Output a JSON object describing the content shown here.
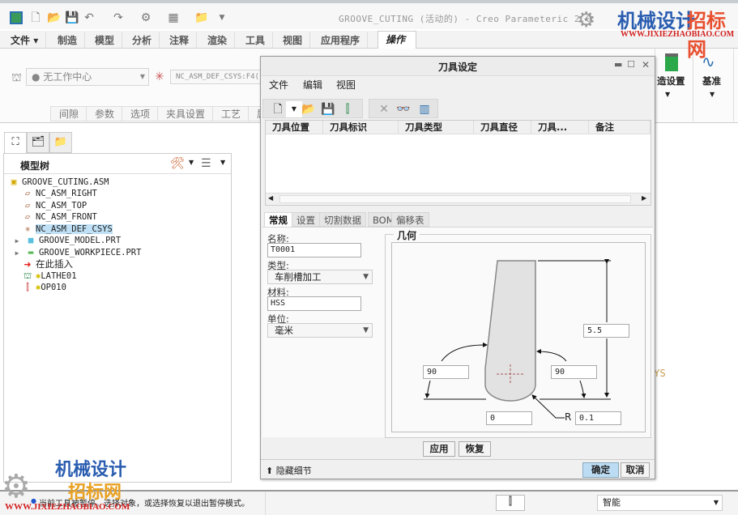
{
  "window": {
    "title": "GROOVE_CUTING (活动的) - Creo Parameteric 2.0"
  },
  "quick_access": {
    "icons": [
      "app-icon",
      "new-icon",
      "open-icon",
      "save-icon",
      "undo-icon",
      "redo-icon",
      "regenerate-icon",
      "windows-icon",
      "close-window-icon",
      "customize-icon"
    ]
  },
  "ribbon": {
    "file_label": "文件",
    "tabs": [
      {
        "label": "制造"
      },
      {
        "label": "模型"
      },
      {
        "label": "分析"
      },
      {
        "label": "注释"
      },
      {
        "label": "渲染"
      },
      {
        "label": "工具"
      },
      {
        "label": "视图"
      },
      {
        "label": "应用程序"
      },
      {
        "label": "操作"
      }
    ],
    "active_tab": "操作",
    "workcenter_value": "无工作中心",
    "csys_value": "NC_ASM_DEF_CSYS:F4(",
    "subtabs": [
      {
        "label": "间隙"
      },
      {
        "label": "参数"
      },
      {
        "label": "选项"
      },
      {
        "label": "夹具设置"
      },
      {
        "label": "工艺"
      },
      {
        "label": "属"
      }
    ],
    "groups": [
      {
        "label": "造设置"
      },
      {
        "label": "基准"
      }
    ]
  },
  "model_tree": {
    "title": "模型树",
    "items": [
      {
        "label": "GROOVE_CUTING.ASM",
        "icon": "assembly-icon"
      },
      {
        "label": "NC_ASM_RIGHT",
        "icon": "datum-plane-icon"
      },
      {
        "label": "NC_ASM_TOP",
        "icon": "datum-plane-icon"
      },
      {
        "label": "NC_ASM_FRONT",
        "icon": "datum-plane-icon"
      },
      {
        "label": "NC_ASM_DEF_CSYS",
        "icon": "csys-icon",
        "selected": true
      },
      {
        "label": "GROOVE_MODEL.PRT",
        "icon": "part-icon"
      },
      {
        "label": "GROOVE_WORKPIECE.PRT",
        "icon": "workpiece-icon"
      },
      {
        "label": "在此插入",
        "icon": "insert-here-arrow-icon"
      },
      {
        "label": "LATHE01",
        "icon": "lathe-icon"
      },
      {
        "label": "OP010",
        "icon": "operation-icon"
      }
    ]
  },
  "graphics": {
    "csys_label": "SYS"
  },
  "dialog": {
    "title": "刀具设定",
    "menus": [
      {
        "label": "文件"
      },
      {
        "label": "编辑"
      },
      {
        "label": "视图"
      }
    ],
    "columns": [
      "刀具位置",
      "刀具标识",
      "刀具类型",
      "刀具直径",
      "刀具...",
      "备注"
    ],
    "tabs": [
      {
        "label": "常规"
      },
      {
        "label": "设置"
      },
      {
        "label": "切割数据"
      },
      {
        "label": "BOM"
      },
      {
        "label": "偏移表"
      }
    ],
    "active_tab": "常规",
    "form": {
      "name_label": "名称:",
      "name_value": "T0001",
      "type_label": "类型:",
      "type_value": "车削槽加工",
      "material_label": "材料:",
      "material_value": "HSS",
      "unit_label": "单位:",
      "unit_value": "毫米"
    },
    "geometry": {
      "title": "几何",
      "length": "5.5",
      "left_angle": "90",
      "right_angle": "90",
      "width": "0",
      "radius_label": "R",
      "radius": "0.1"
    },
    "apply_label": "应用",
    "revert_label": "恢复",
    "hide_details_label": "隐藏细节",
    "ok_label": "确定",
    "cancel_label": "取消"
  },
  "status": {
    "message": "当前工具被暂停。选择对象，或选择恢复以退出暂停模式。",
    "filter_value": "智能"
  },
  "watermark": {
    "name_part1": "机械设计",
    "name_part2": "招标网",
    "url": "WWW.JIXIEZHAOBIAO.COM"
  },
  "colors": {
    "selection": "#bfe0f5",
    "ok_button": "#bcdcf4",
    "watermark_blue": "#2a5db0",
    "watermark_orange": "#e8a020",
    "watermark_red": "#d42020"
  }
}
